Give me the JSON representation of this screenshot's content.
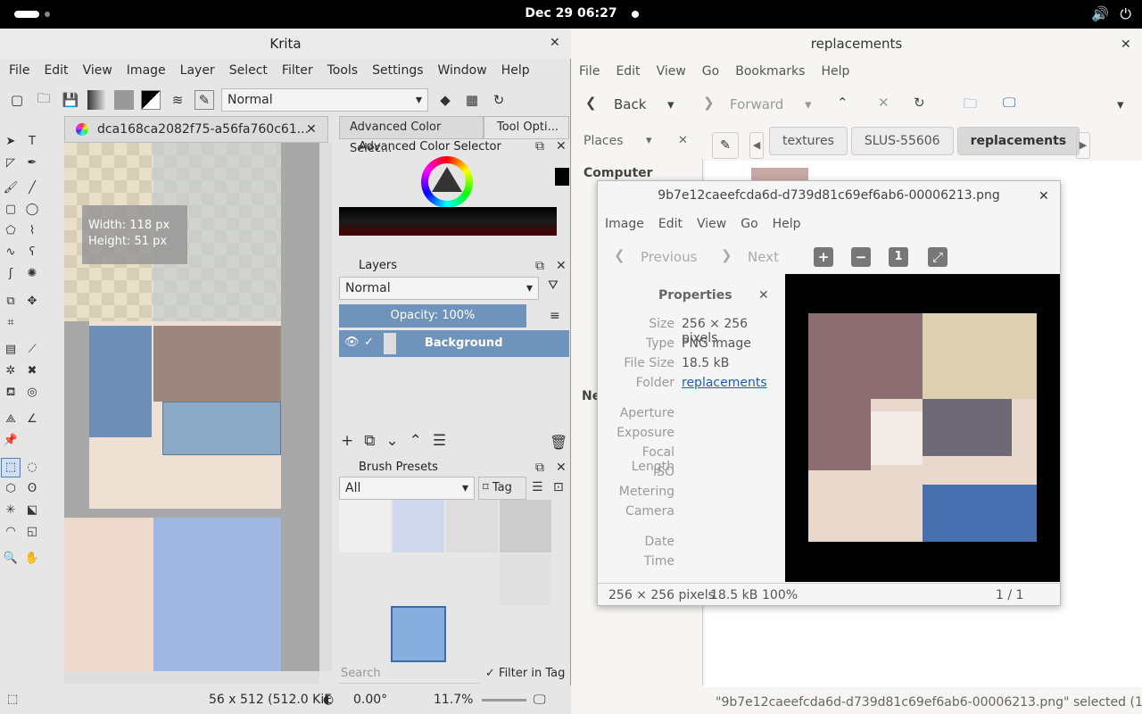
{
  "topbar": {
    "datetime": "Dec 29  06:27"
  },
  "krita": {
    "title": "Krita",
    "menu": [
      "File",
      "Edit",
      "View",
      "Image",
      "Layer",
      "Select",
      "Filter",
      "Tools",
      "Settings",
      "Window",
      "Help"
    ],
    "blend_mode": "Normal",
    "doc_tab": "dca168ca2082f75-a56fa760c61...",
    "tooltip": {
      "width": "Width: 118 px",
      "height": "Height: 51 px"
    },
    "dock_tabs": [
      "Advanced Color Selec...",
      "Tool Opti..."
    ],
    "color_selector_title": "Advanced Color Selector",
    "layers": {
      "title": "Layers",
      "blend": "Normal",
      "opacity": "Opacity:  100%",
      "layer_name": "Background"
    },
    "brushes": {
      "title": "Brush Presets",
      "filter": "All",
      "tag": "Tag",
      "search_placeholder": "Search",
      "filter_in_tag": "Filter in Tag"
    },
    "status": {
      "size": "56 x 512 (512.0 KiE",
      "rotation": "0.00°",
      "zoom": "11.7%"
    }
  },
  "nautilus": {
    "title": "replacements",
    "menu": [
      "File",
      "Edit",
      "View",
      "Go",
      "Bookmarks",
      "Help"
    ],
    "back": "Back",
    "forward": "Forward",
    "places": "Places",
    "computer": "Computer",
    "network_prefix": "Ne",
    "crumbs": [
      "textures",
      "SLUS-55606",
      "replacements"
    ],
    "status": "\"9b7e12caeefcda6d-d739d81c69ef6ab6-00006213.png\" selected (1..."
  },
  "viewer": {
    "title": "9b7e12caeefcda6d-d739d81c69ef6ab6-00006213.png",
    "menu": [
      "Image",
      "Edit",
      "View",
      "Go",
      "Help"
    ],
    "previous": "Previous",
    "next": "Next",
    "one_to_one": "1",
    "properties_title": "Properties",
    "props": [
      {
        "k": "Size",
        "v": "256 × 256 pixels"
      },
      {
        "k": "Type",
        "v": "PNG image"
      },
      {
        "k": "File Size",
        "v": "18.5 kB"
      },
      {
        "k": "Folder",
        "v": "replacements"
      }
    ],
    "empty_props": [
      "Aperture",
      "Exposure",
      "Focal Length",
      "ISO",
      "Metering",
      "Camera"
    ],
    "empty_props2": [
      "Date",
      "Time"
    ],
    "status": {
      "dims": "256 × 256 pixels",
      "size": "18.5 kB",
      "zoom": "100%",
      "page": "1 / 1"
    }
  }
}
